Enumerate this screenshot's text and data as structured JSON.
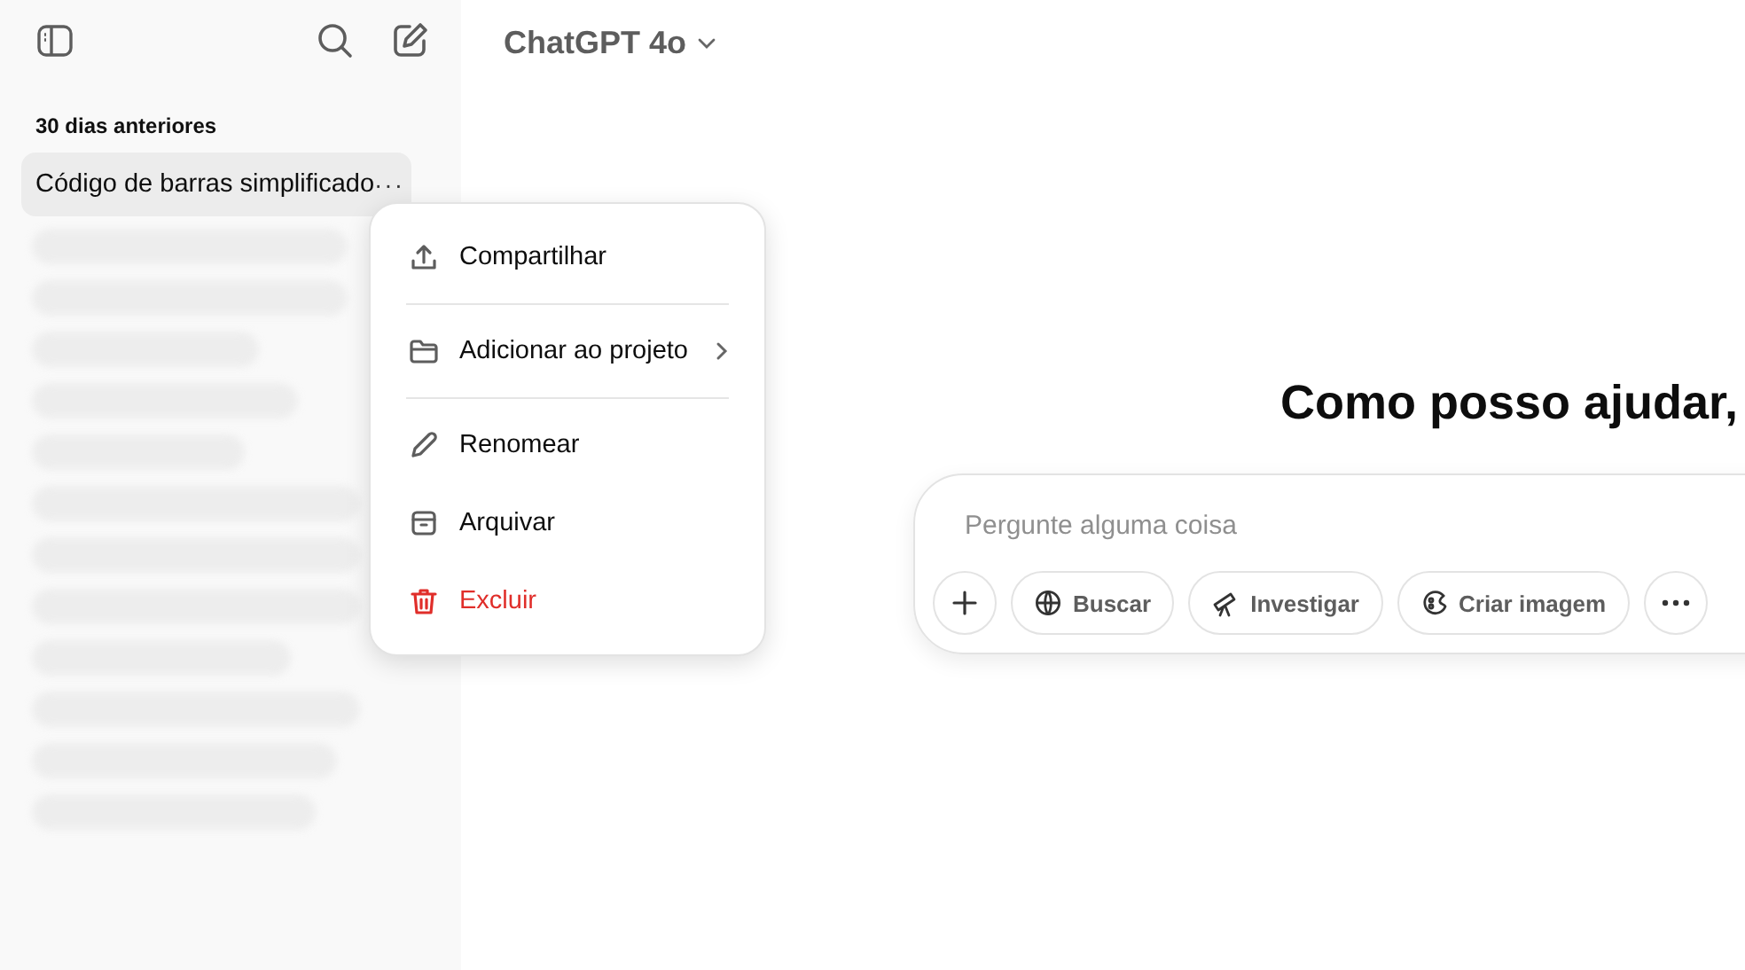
{
  "sidebar": {
    "section_title": "30 dias anteriores",
    "items": [
      {
        "kind": "chat",
        "label": "Código de barras simplificado",
        "selected": true
      },
      {
        "kind": "redacted",
        "selected": false
      },
      {
        "kind": "redacted",
        "selected": false
      },
      {
        "kind": "redacted",
        "selected": false
      },
      {
        "kind": "redacted",
        "selected": false
      },
      {
        "kind": "redacted",
        "selected": false
      },
      {
        "kind": "redacted",
        "selected": false
      },
      {
        "kind": "redacted",
        "selected": false
      },
      {
        "kind": "redacted",
        "selected": false
      },
      {
        "kind": "redacted",
        "selected": false
      },
      {
        "kind": "redacted",
        "selected": false
      },
      {
        "kind": "redacted",
        "selected": false
      },
      {
        "kind": "redacted",
        "selected": false
      }
    ],
    "more_button": "···"
  },
  "model_selector": {
    "label": "ChatGPT 4o"
  },
  "context_menu": {
    "items": [
      {
        "kind": "share",
        "label": "Compartilhar",
        "submenu": false,
        "danger": false
      },
      {
        "kind": "folder",
        "label": "Adicionar ao projeto",
        "submenu": true,
        "danger": false
      },
      {
        "kind": "rename",
        "label": "Renomear",
        "submenu": false,
        "danger": false
      },
      {
        "kind": "archive",
        "label": "Arquivar",
        "submenu": false,
        "danger": false
      },
      {
        "kind": "delete",
        "label": "Excluir",
        "submenu": false,
        "danger": true
      }
    ]
  },
  "heading": "Como posso ajudar,",
  "composer": {
    "placeholder": "Pergunte alguma coisa",
    "tools": [
      {
        "kind": "plus"
      },
      {
        "kind": "globe",
        "label": "Buscar"
      },
      {
        "kind": "telescope",
        "label": "Investigar"
      },
      {
        "kind": "palette",
        "label": "Criar imagem"
      },
      {
        "kind": "more"
      }
    ]
  }
}
